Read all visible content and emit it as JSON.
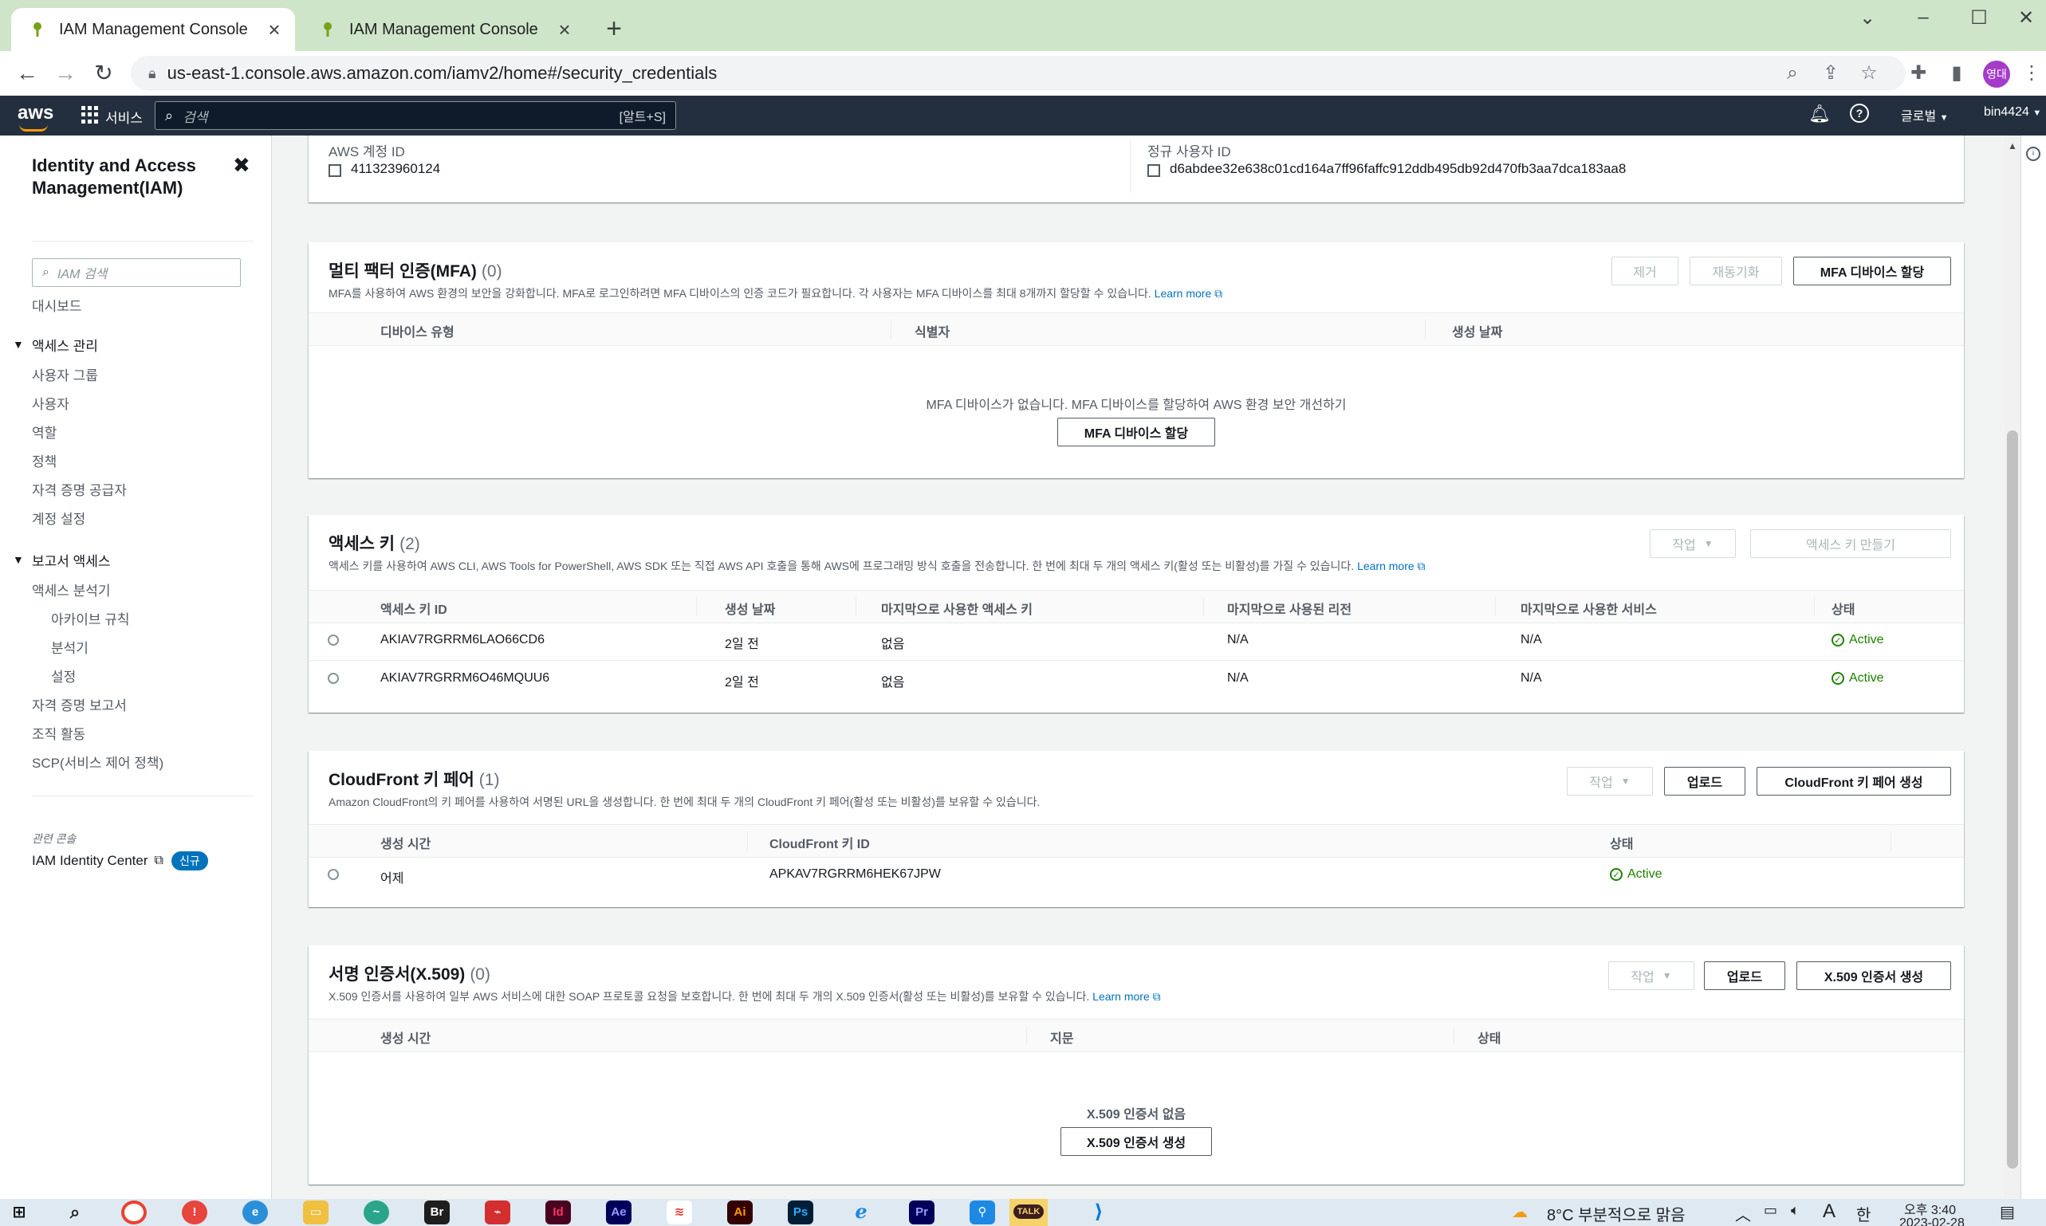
{
  "browser": {
    "tabs": [
      {
        "title": "IAM Management Console",
        "active": true
      },
      {
        "title": "IAM Management Console",
        "active": false
      }
    ],
    "new_tab": "+",
    "url": "us-east-1.console.aws.amazon.com/iamv2/home#/security_credentials",
    "profile_initials": "영대"
  },
  "aws_nav": {
    "logo": "aws",
    "services_label": "서비스",
    "search_placeholder": "검색",
    "search_shortcut": "[알트+S]",
    "region": "글로벌",
    "account": "bin4424"
  },
  "sidebar": {
    "title": "Identity and Access Management(IAM)",
    "search_placeholder": "IAM 검색",
    "dashboard": "대시보드",
    "access_management": {
      "label": "액세스 관리",
      "items": [
        "사용자 그룹",
        "사용자",
        "역할",
        "정책",
        "자격 증명 공급자",
        "계정 설정"
      ]
    },
    "access_reports": {
      "label": "보고서 액세스",
      "analyzer": "액세스 분석기",
      "analyzer_items": [
        "아카이브 규칙",
        "분석기",
        "설정"
      ],
      "items": [
        "자격 증명 보고서",
        "조직 활동",
        "SCP(서비스 제어 정책)"
      ]
    },
    "related_label": "관련 콘솔",
    "identity_center": "IAM Identity Center",
    "new_badge": "신규"
  },
  "account_info": {
    "account_id_label": "AWS 계정 ID",
    "account_id": "411323960124",
    "canonical_label": "정규 사용자 ID",
    "canonical_id": "d6abdee32e638c01cd164a7ff96faffc912ddb495db92d470fb3aa7dca183aa8"
  },
  "mfa": {
    "title": "멀티 팩터 인증(MFA)",
    "count": "(0)",
    "description": "MFA를 사용하여 AWS 환경의 보안을 강화합니다. MFA로 로그인하려면 MFA 디바이스의 인증 코드가 필요합니다. 각 사용자는 MFA 디바이스를 최대 8개까지 할당할 수 있습니다.",
    "learn_more": "Learn more",
    "buttons": {
      "remove": "제거",
      "resync": "재동기화",
      "assign": "MFA 디바이스 할당"
    },
    "columns": [
      "디바이스 유형",
      "식별자",
      "생성 날짜"
    ],
    "empty_message": "MFA 디바이스가 없습니다. MFA 디바이스를 할당하여 AWS 환경 보안 개선하기",
    "empty_button": "MFA 디바이스 할당"
  },
  "access_keys": {
    "title": "액세스 키",
    "count": "(2)",
    "description": "액세스 키를 사용하여 AWS CLI, AWS Tools for PowerShell, AWS SDK 또는 직접 AWS API 호출을 통해 AWS에 프로그래밍 방식 호출을 전송합니다. 한 번에 최대 두 개의 액세스 키(활성 또는 비활성)를 가질 수 있습니다.",
    "learn_more": "Learn more",
    "buttons": {
      "actions": "작업",
      "create": "액세스 키 만들기"
    },
    "columns": [
      "액세스 키 ID",
      "생성 날짜",
      "마지막으로 사용한 액세스 키",
      "마지막으로 사용된 리전",
      "마지막으로 사용한 서비스",
      "상태"
    ],
    "rows": [
      {
        "id": "AKIAV7RGRRM6LAO66CD6",
        "created": "2일 전",
        "last_used": "없음",
        "region": "N/A",
        "service": "N/A",
        "status": "Active"
      },
      {
        "id": "AKIAV7RGRRM6O46MQUU6",
        "created": "2일 전",
        "last_used": "없음",
        "region": "N/A",
        "service": "N/A",
        "status": "Active"
      }
    ]
  },
  "cloudfront": {
    "title": "CloudFront 키 페어",
    "count": "(1)",
    "description": "Amazon CloudFront의 키 페어를 사용하여 서명된 URL을 생성합니다. 한 번에 최대 두 개의 CloudFront 키 페어(활성 또는 비활성)를 보유할 수 있습니다.",
    "buttons": {
      "actions": "작업",
      "upload": "업로드",
      "create": "CloudFront 키 페어 생성"
    },
    "columns": [
      "생성 시간",
      "CloudFront 키 ID",
      "상태"
    ],
    "rows": [
      {
        "created": "어제",
        "id": "APKAV7RGRRM6HEK67JPW",
        "status": "Active"
      }
    ]
  },
  "x509": {
    "title": "서명 인증서(X.509)",
    "count": "(0)",
    "description": "X.509 인증서를 사용하여 일부 AWS 서비스에 대한 SOAP 프로토콜 요청을 보호합니다. 한 번에 최대 두 개의 X.509 인증서(활성 또는 비활성)를 보유할 수 있습니다.",
    "learn_more": "Learn more",
    "buttons": {
      "actions": "작업",
      "upload": "업로드",
      "create": "X.509 인증서 생성"
    },
    "columns": [
      "생성 시간",
      "지문",
      "상태"
    ],
    "empty_message": "X.509 인증서 없음",
    "empty_button": "X.509 인증서 생성"
  },
  "taskbar": {
    "weather": "8°C 부분적으로 맑음",
    "time": "오후 3:40",
    "date": "2023-02-28",
    "ime_a": "A",
    "ime_han": "한",
    "apps": [
      "Br",
      "Id",
      "Ae",
      "Ai",
      "Ps",
      "Pr",
      "TALK"
    ]
  },
  "colors": {
    "tab_bar": "#cfe5c9",
    "aws_nav": "#232f3e",
    "aws_orange": "#ff9900",
    "link": "#0073bb",
    "active_green": "#1d8102"
  }
}
